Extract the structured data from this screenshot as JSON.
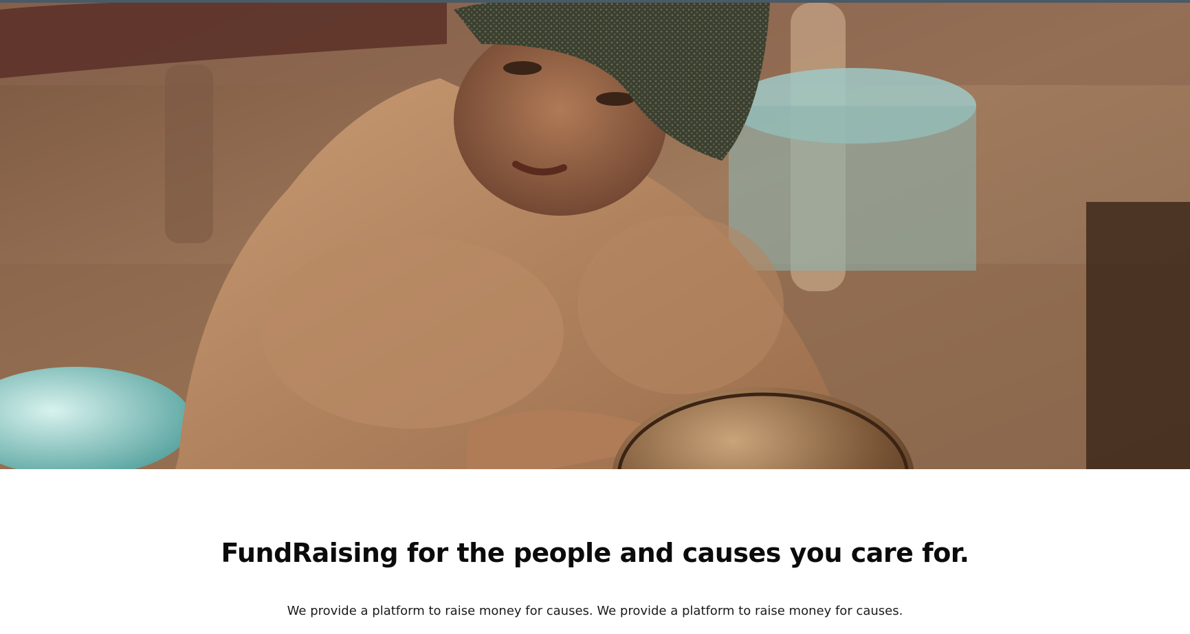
{
  "hero": {
    "image_subject": "child-with-metal-plate-photo",
    "accent_color": "#4a5a66"
  },
  "headline": "FundRaising for the people and causes you care for.",
  "subtext": "We provide a platform to raise money for causes. We provide a platform to raise money for causes."
}
